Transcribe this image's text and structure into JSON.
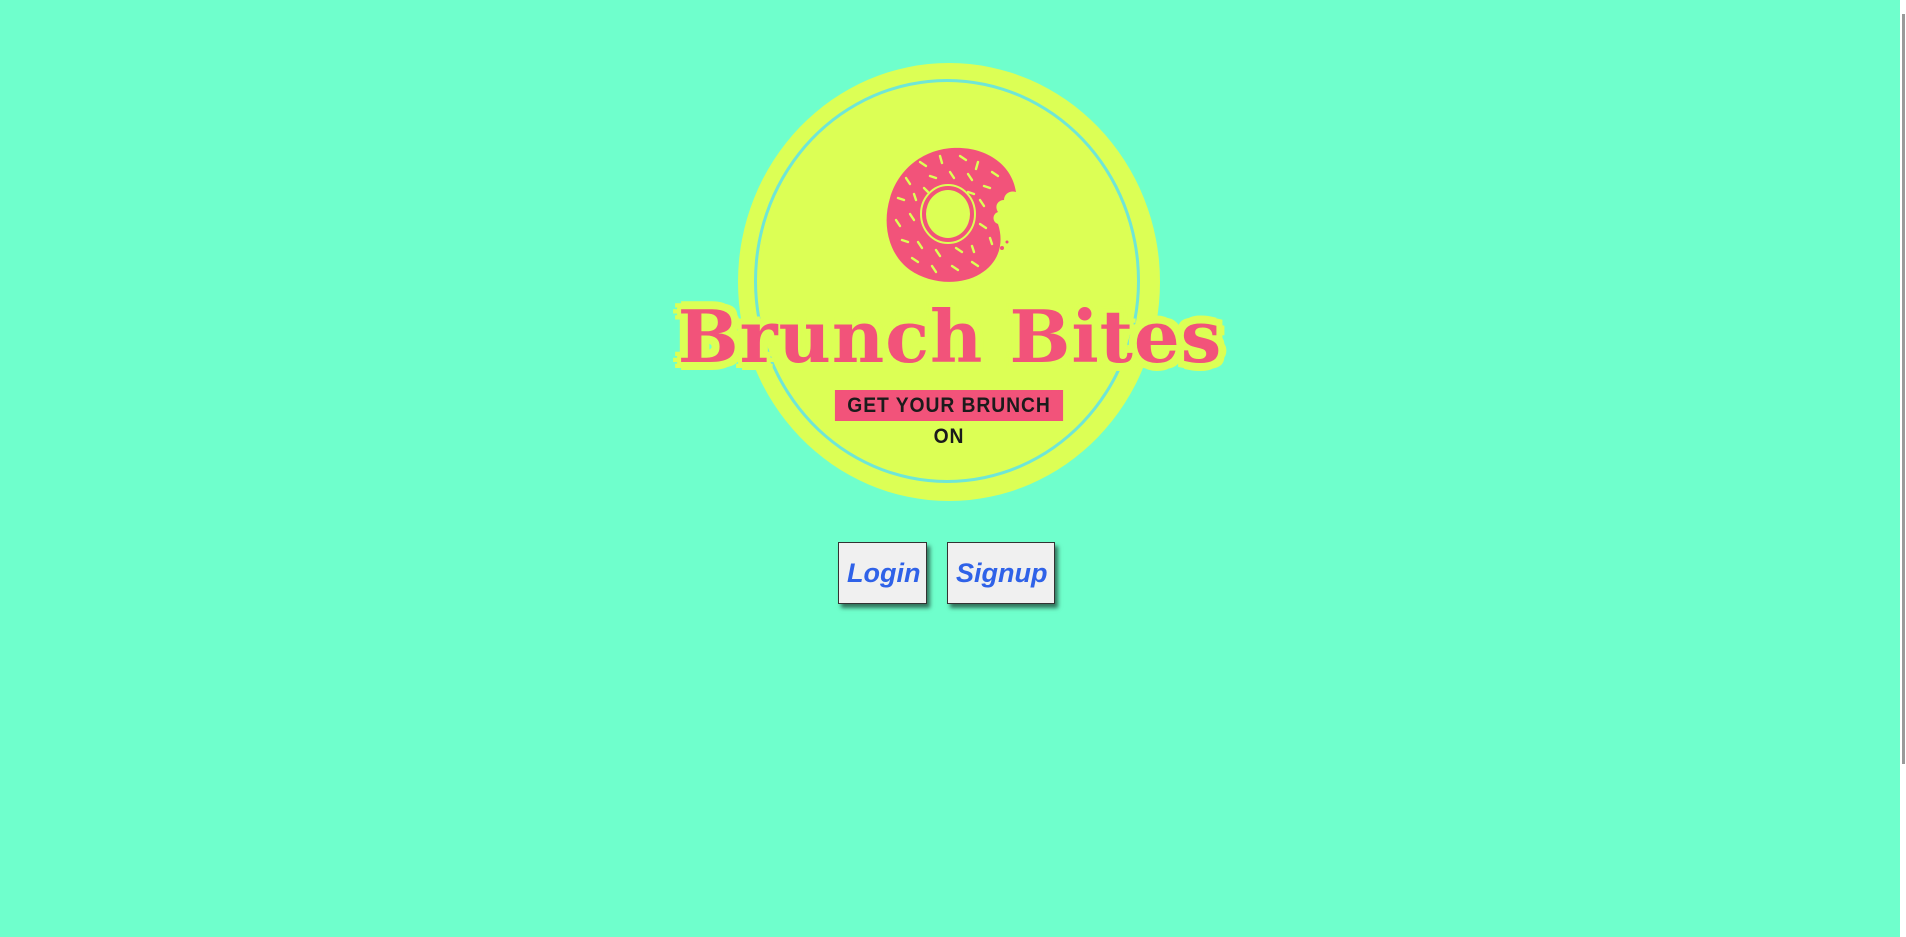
{
  "colors": {
    "background": "#6fffcc",
    "logo_circle": "#dcff55",
    "accent_pink": "#f2537a",
    "button_text": "#2f62e8"
  },
  "logo": {
    "title": "Brunch Bites",
    "tagline": "GET YOUR BRUNCH ON",
    "icon": "donut-icon"
  },
  "actions": {
    "login_label": "Login",
    "signup_label": "Signup"
  }
}
